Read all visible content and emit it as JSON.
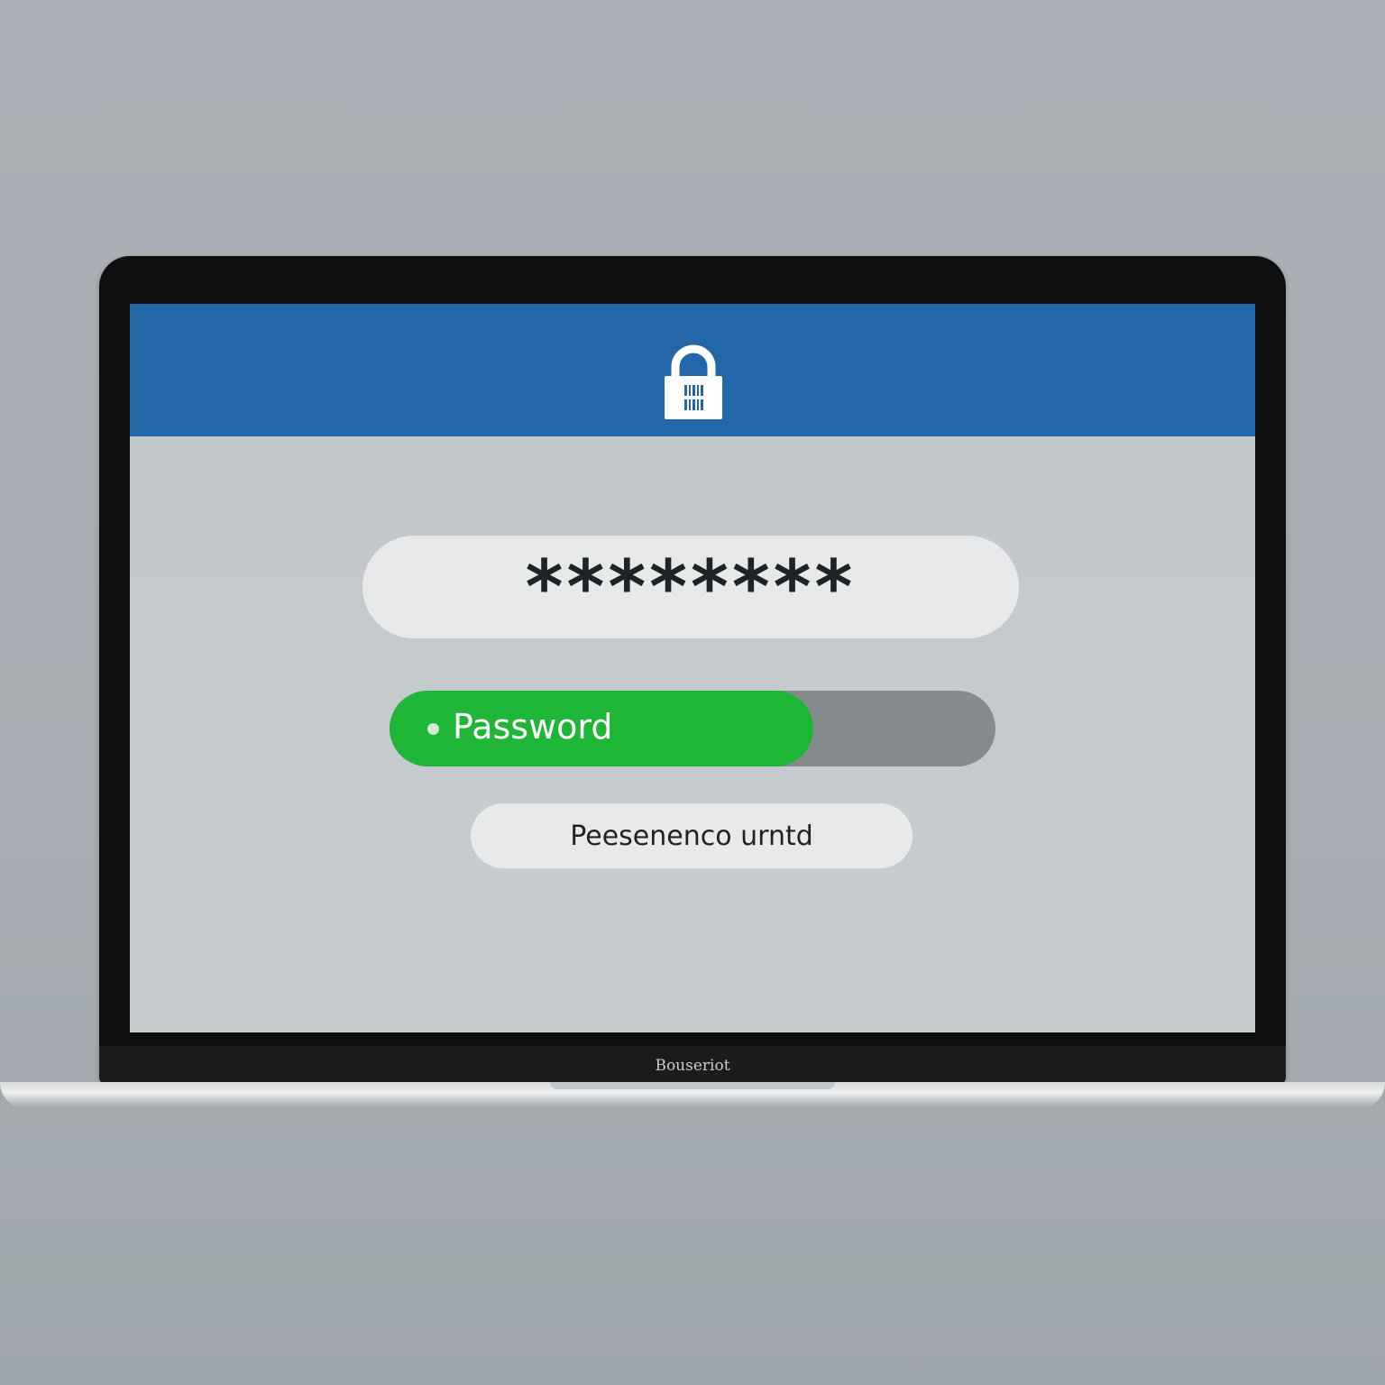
{
  "header": {
    "icon": "lock-icon",
    "color": "#2467a8"
  },
  "password_field": {
    "masked_value": "********"
  },
  "strength": {
    "label": "Password",
    "fill_fraction": 0.7,
    "fill_color": "#1fb536",
    "track_color": "#858a8c"
  },
  "submit": {
    "label": "Peesenenco urntd"
  },
  "laptop": {
    "brand": "Bouseriot"
  }
}
